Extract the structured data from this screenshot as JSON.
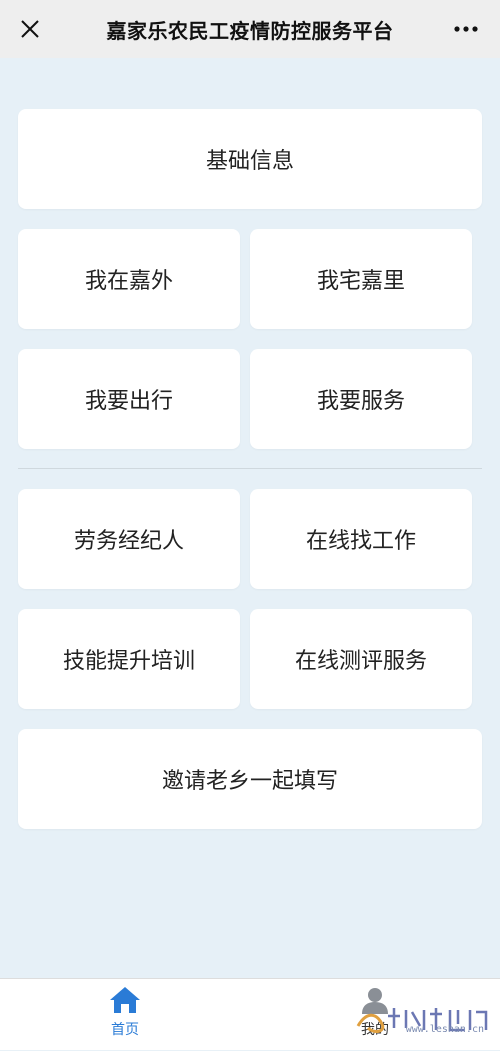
{
  "titlebar": {
    "title": "嘉家乐农民工疫情防控服务平台",
    "close_icon": "close-icon",
    "more_icon": "more-dots-icon"
  },
  "menu": {
    "basic_info": "基础信息",
    "outside_jia": "我在嘉外",
    "home_jia": "我宅嘉里",
    "travel": "我要出行",
    "service": "我要服务",
    "labor_agent": "劳务经纪人",
    "find_job": "在线找工作",
    "skill_training": "技能提升培训",
    "online_assessment": "在线测评服务",
    "invite": "邀请老乡一起填写"
  },
  "tabbar": {
    "home_label": "首页",
    "mine_label": "我的",
    "active_color": "#2a7bd6"
  },
  "watermark": {
    "site": "www.leshan.cn"
  }
}
